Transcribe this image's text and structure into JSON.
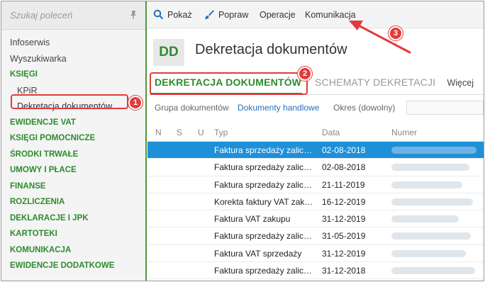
{
  "sidebar": {
    "search_placeholder": "Szukaj poleceń",
    "items": [
      {
        "label": "Infoserwis"
      },
      {
        "label": "Wyszukiwarka"
      },
      {
        "label": "KSIĘGI"
      },
      {
        "label": "KPiR"
      },
      {
        "label": "Dekretacja dokumentów"
      },
      {
        "label": "EWIDENCJE VAT"
      },
      {
        "label": "KSIĘGI POMOCNICZE"
      },
      {
        "label": "ŚRODKI TRWAŁE"
      },
      {
        "label": "UMOWY I PŁACE"
      },
      {
        "label": "FINANSE"
      },
      {
        "label": "ROZLICZENIA"
      },
      {
        "label": "DEKLARACJE I JPK"
      },
      {
        "label": "KARTOTEKI"
      },
      {
        "label": "KOMUNIKACJA"
      },
      {
        "label": "EWIDENCJE DODATKOWE"
      }
    ]
  },
  "toolbar": {
    "show_label": "Pokaż",
    "fix_label": "Popraw",
    "operations_label": "Operacje",
    "communication_label": "Komunikacja"
  },
  "header": {
    "badge": "DD",
    "title": "Dekretacja dokumentów"
  },
  "tabs": {
    "items": [
      {
        "label": "DEKRETACJA DOKUMENTÓW"
      },
      {
        "label": "SCHEMATY DEKRETACJI"
      }
    ],
    "more_label": "Więcej"
  },
  "filters": {
    "group_label": "Grupa dokumentów",
    "group_value": "Dokumenty handlowe",
    "period_label": "Okres (dowolny)"
  },
  "grid": {
    "columns": [
      "N",
      "S",
      "U",
      "Typ",
      "Data",
      "Numer"
    ],
    "rows": [
      {
        "typ": "Faktura sprzedaży zalic…",
        "data": "02-08-2018"
      },
      {
        "typ": "Faktura sprzedaży zalic…",
        "data": "02-08-2018"
      },
      {
        "typ": "Faktura sprzedaży zalic…",
        "data": "21-11-2019"
      },
      {
        "typ": "Korekta faktury VAT zak…",
        "data": "16-12-2019"
      },
      {
        "typ": "Faktura VAT zakupu",
        "data": "31-12-2019"
      },
      {
        "typ": "Faktura sprzedaży zalic…",
        "data": "31-05-2019"
      },
      {
        "typ": "Faktura VAT sprzedaży",
        "data": "31-12-2019"
      },
      {
        "typ": "Faktura sprzedaży zalic…",
        "data": "31-12-2018"
      }
    ]
  },
  "annotations": {
    "one": "1",
    "two": "2",
    "three": "3"
  },
  "colors": {
    "accent_green": "#2e8b2e",
    "selection_blue": "#1e90d8",
    "annotation_red": "#e23b3b"
  }
}
